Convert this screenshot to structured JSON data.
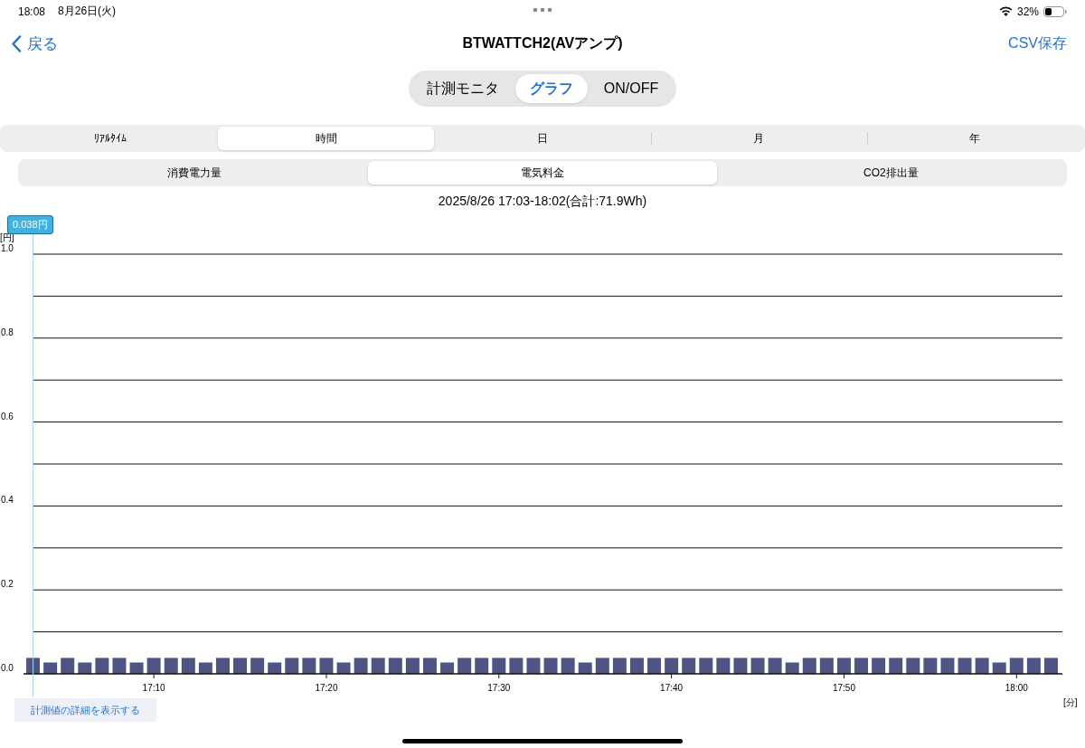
{
  "status_bar": {
    "time": "18:08",
    "date": "8月26日(火)",
    "battery": "32%"
  },
  "nav": {
    "back": "戻る",
    "title": "BTWATTCH2(AVアンプ)",
    "action": "CSV保存"
  },
  "mode_tabs": [
    {
      "label": "計測モニタ",
      "selected": false
    },
    {
      "label": "グラフ",
      "selected": true
    },
    {
      "label": "ON/OFF",
      "selected": false
    }
  ],
  "period_tabs": [
    {
      "label": "ﾘｱﾙﾀｲﾑ",
      "selected": false
    },
    {
      "label": "時間",
      "selected": true
    },
    {
      "label": "日",
      "selected": false
    },
    {
      "label": "月",
      "selected": false
    },
    {
      "label": "年",
      "selected": false
    }
  ],
  "metric_tabs": [
    {
      "label": "消費電力量",
      "selected": false
    },
    {
      "label": "電気料金",
      "selected": true
    },
    {
      "label": "CO2排出量",
      "selected": false
    }
  ],
  "range_title": "2025/8/26 17:03-18:02(合計:71.9Wh)",
  "chart": {
    "chart_data": {
      "type": "bar",
      "ylabel": "[円]",
      "xlabel": "[分]",
      "categories": [
        null,
        null,
        null,
        null,
        null,
        null,
        null,
        "17:10",
        null,
        null,
        null,
        null,
        null,
        null,
        null,
        null,
        null,
        "17:20",
        null,
        null,
        null,
        null,
        null,
        null,
        null,
        null,
        null,
        "17:30",
        null,
        null,
        null,
        null,
        null,
        null,
        null,
        null,
        null,
        "17:40",
        null,
        null,
        null,
        null,
        null,
        null,
        null,
        null,
        null,
        "17:50",
        null,
        null,
        null,
        null,
        null,
        null,
        null,
        null,
        null,
        "18:00",
        null,
        null
      ],
      "grid": true,
      "values": [
        0.038,
        0.027,
        0.038,
        0.027,
        0.038,
        0.038,
        0.027,
        0.038,
        0.038,
        0.038,
        0.027,
        0.038,
        0.038,
        0.038,
        0.027,
        0.038,
        0.038,
        0.038,
        0.027,
        0.038,
        0.038,
        0.038,
        0.038,
        0.038,
        0.027,
        0.038,
        0.038,
        0.038,
        0.038,
        0.038,
        0.038,
        0.038,
        0.027,
        0.038,
        0.038,
        0.038,
        0.038,
        0.038,
        0.038,
        0.038,
        0.038,
        0.038,
        0.038,
        0.038,
        0.027,
        0.038,
        0.038,
        0.038,
        0.038,
        0.038,
        0.038,
        0.038,
        0.038,
        0.038,
        0.038,
        0.038,
        0.027,
        0.038,
        0.038,
        0.038
      ],
      "ylim": [
        0,
        1.0
      ],
      "yticks": [
        {
          "value": 0,
          "label": "0.0"
        },
        {
          "value": 0.2,
          "label": "0.2"
        },
        {
          "value": 0.4,
          "label": "0.4"
        },
        {
          "value": 0.6,
          "label": "0.6"
        },
        {
          "value": 0.8,
          "label": "0.8"
        },
        {
          "value": 1.0,
          "label": "1.0"
        }
      ],
      "annotations": [
        "0.038円"
      ]
    },
    "detail_button": "計測値の詳細を表示する"
  }
}
